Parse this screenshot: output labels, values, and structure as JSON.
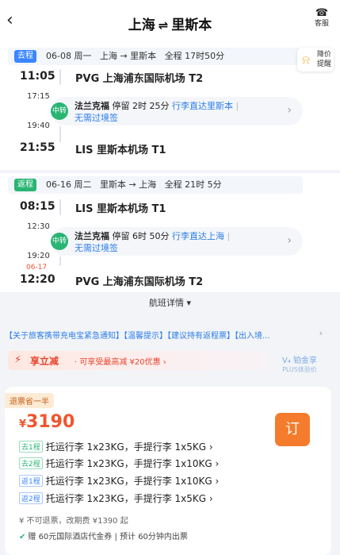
{
  "header": {
    "from": "上海",
    "swap_icon": "⇌",
    "to": "里斯本",
    "service_label": "客服"
  },
  "price_reminder": {
    "label_line1": "降价",
    "label_line2": "提醒"
  },
  "outbound": {
    "tag": "去程",
    "date": "06-08 周一",
    "route": "上海 → 里斯本",
    "duration": "全程 17时50分",
    "dep_time": "11:05",
    "dep_airport": "PVG 上海浦东国际机场 T2",
    "transfer": {
      "badge": "中转",
      "arr_time": "17:15",
      "dep_time": "19:40",
      "city": "法兰克福",
      "wait": "停留 2时 25分",
      "note": "行李直达里斯本",
      "visa": "无需过境签"
    },
    "arr_time": "21:55",
    "arr_airport": "LIS 里斯本机场 T1"
  },
  "inbound": {
    "tag": "返程",
    "date": "06-16 周二",
    "route": "里斯本 → 上海",
    "duration": "全程 21时 5分",
    "dep_time": "08:15",
    "dep_airport": "LIS 里斯本机场 T1",
    "transfer": {
      "badge": "中转",
      "arr_time": "12:30",
      "dep_time": "19:20",
      "city": "法兰克福",
      "wait": "停留 6时 50分",
      "note": "行李直达上海",
      "visa": "无需过境签"
    },
    "arr_date": "06-17",
    "arr_time": "12:20",
    "arr_airport": "PVG 上海浦东国际机场 T2"
  },
  "flight_detail_link": "航班详情 ▾",
  "notice_text": "【关于旅客携带充电宝紧急通知】【温馨提示】【建议持有返程票】【出入境...",
  "promo": {
    "title": "享立减",
    "desc": "· 可享受最高减 ¥20优惠  ›",
    "plus_line1": "V₄ 铂金享",
    "plus_line2": "PLUS体验价"
  },
  "fare": {
    "badge": "退票省一半",
    "currency": "¥",
    "price": "3190",
    "book_label": "订",
    "baggage": [
      {
        "tag": "去1程",
        "text": "托运行李 1x23KG，手提行李 1x5KG ›"
      },
      {
        "tag": "去2程",
        "text": "托运行李 1x23KG，手提行李 1x10KG ›"
      },
      {
        "tag": "返1程",
        "text": "托运行李 1x23KG，手提行李 1x10KG ›"
      },
      {
        "tag": "返2程",
        "text": "托运行李 1x23KG，手提行李 1x5KG ›"
      }
    ],
    "refund": "¥ 不可退票，改期费 ¥1390 起",
    "coupon": "赠 60元国际酒店代金券 | 预计 60分钟内出票"
  },
  "colors": {
    "accent_blue": "#3a86ff",
    "accent_green": "#29b573",
    "price_orange": "#f0552c",
    "book_orange": "#f57b2d"
  },
  "icons": {
    "back": "chevron-left-icon",
    "service": "headset-icon",
    "bell": "bell-icon",
    "promo": "lightning-icon",
    "check": "check-icon"
  }
}
